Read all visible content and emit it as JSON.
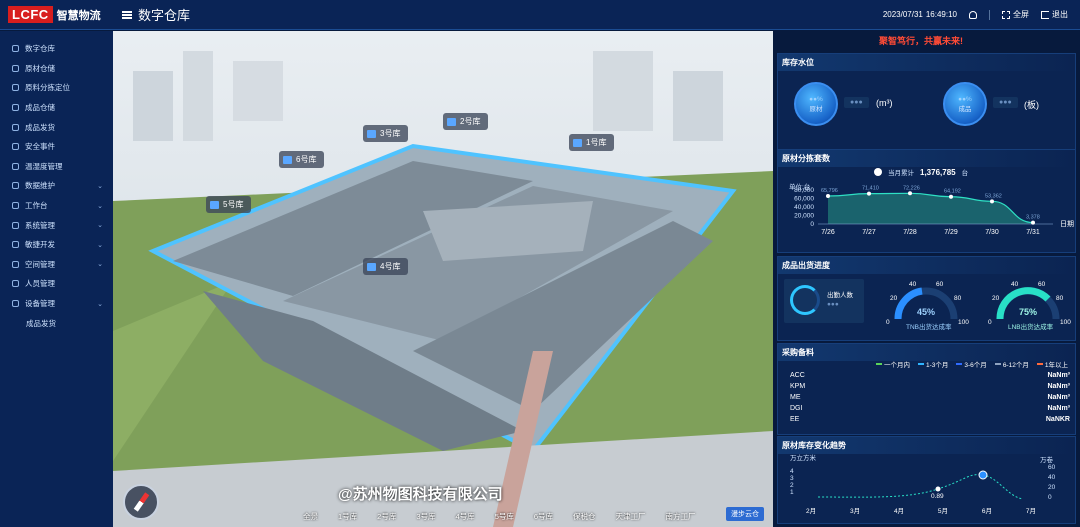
{
  "header": {
    "logo_mark": "LCFC",
    "logo_text": "智慧物流",
    "page_title": "数字仓库",
    "date": "2023/07/31",
    "time": "16:49:10",
    "fullscreen": "全屏",
    "logout": "退出"
  },
  "sidebar": {
    "items": [
      {
        "label": "数字仓库",
        "icon": "grid-icon",
        "chevron": false
      },
      {
        "label": "原材仓储",
        "icon": "database-icon",
        "chevron": false
      },
      {
        "label": "原料分拣定位",
        "icon": "search-icon",
        "chevron": false
      },
      {
        "label": "成品仓储",
        "icon": "box-icon",
        "chevron": false
      },
      {
        "label": "成品发货",
        "icon": "chart-icon",
        "chevron": false
      },
      {
        "label": "安全事件",
        "icon": "shield-icon",
        "chevron": false
      },
      {
        "label": "温湿度管理",
        "icon": "gear-icon",
        "chevron": false
      },
      {
        "label": "数据维护",
        "icon": "monitor-icon",
        "chevron": true
      },
      {
        "label": "工作台",
        "icon": "folder-icon",
        "chevron": true
      },
      {
        "label": "系统管理",
        "icon": "cog-icon",
        "chevron": true
      },
      {
        "label": "敏捷开发",
        "icon": "send-icon",
        "chevron": true
      },
      {
        "label": "空间管理",
        "icon": "layers-icon",
        "chevron": true
      },
      {
        "label": "人员管理",
        "icon": "user-icon",
        "chevron": false
      },
      {
        "label": "设备管理",
        "icon": "device-icon",
        "chevron": true
      },
      {
        "label": "成品发货",
        "icon": "",
        "chevron": false
      }
    ]
  },
  "scene": {
    "warehouses": [
      "1号库",
      "2号库",
      "3号库",
      "4号库",
      "5号库",
      "6号库"
    ],
    "watermark": "@苏州物图科技有限公司",
    "tabs": [
      "全景",
      "1号库",
      "2号库",
      "3号库",
      "4号库",
      "5号库",
      "6号库",
      "保税仓",
      "天津工厂",
      "南方工厂"
    ],
    "roam_button": "漫步云仓"
  },
  "right": {
    "slogan": "聚智笃行，共赢未来!",
    "inventory": {
      "title": "库存水位",
      "raw": {
        "label": "原材",
        "unit": "(m³)"
      },
      "finished": {
        "label": "成品",
        "unit": "(板)"
      }
    },
    "sorting": {
      "title": "原材分拣套数",
      "month_label": "当月累计",
      "month_value": "1,376,785",
      "month_unit": "台",
      "unit_label": "单位:台",
      "x_axis_label": "日期"
    },
    "shipping": {
      "title": "成品出货进度",
      "people_label": "出勤人数",
      "gauge1_value": "45%",
      "gauge1_label": "TNB出货达成率",
      "gauge2_value": "75%",
      "gauge2_label": "LNB出货达成率"
    },
    "procurement": {
      "title": "采购备料",
      "legend": [
        "一个月内",
        "1-3个月",
        "3-6个月",
        "6-12个月",
        "1年以上"
      ],
      "rows": [
        {
          "name": "ACC",
          "value": "NaNm³"
        },
        {
          "name": "KPM",
          "value": "NaNm³"
        },
        {
          "name": "ME",
          "value": "NaNm³"
        },
        {
          "name": "DGI",
          "value": "NaNm³"
        },
        {
          "name": "EE",
          "value": "NaNKR"
        }
      ]
    },
    "trend": {
      "title": "原材库存变化趋势",
      "left_unit": "万立方米",
      "right_unit": "万卷",
      "x": [
        "2月",
        "3月",
        "4月",
        "5月",
        "6月",
        "7月"
      ],
      "highlight_value": "0.89",
      "right_ticks": [
        "60",
        "40",
        "20",
        "0"
      ],
      "left_ticks": [
        "4",
        "3",
        "2",
        "1"
      ]
    }
  },
  "chart_data": {
    "type": "area",
    "categories": [
      "7/26",
      "7/27",
      "7/28",
      "7/29",
      "7/30",
      "7/31"
    ],
    "values": [
      65796,
      71410,
      72226,
      64192,
      53362,
      3378
    ],
    "title": "原材分拣套数",
    "xlabel": "日期",
    "ylabel": "单位:台",
    "ylim": [
      0,
      80000
    ],
    "yticks": [
      "80,000",
      "60,000",
      "40,000",
      "20,000",
      "0"
    ],
    "grid": false
  }
}
